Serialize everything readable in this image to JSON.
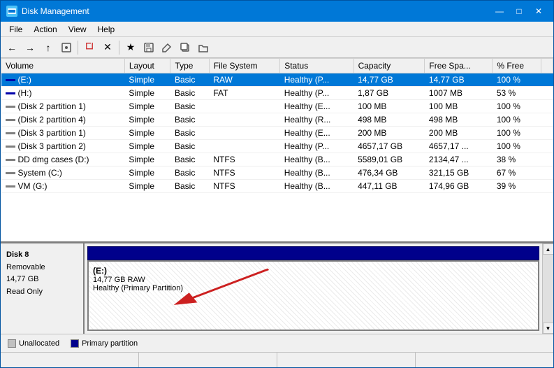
{
  "window": {
    "title": "Disk Management",
    "icon": "💿"
  },
  "titlebar": {
    "minimize": "—",
    "maximize": "□",
    "close": "✕"
  },
  "menu": {
    "items": [
      "File",
      "Action",
      "View",
      "Help"
    ]
  },
  "toolbar": {
    "buttons": [
      "←",
      "→",
      "⬆",
      "🖥",
      "📄",
      "🗑",
      "✕",
      "⭐",
      "💾",
      "✏",
      "📋",
      "📂"
    ]
  },
  "table": {
    "headers": [
      "Volume",
      "Layout",
      "Type",
      "File System",
      "Status",
      "Capacity",
      "Free Spa...",
      "% Free",
      ""
    ],
    "rows": [
      {
        "volume": "(E:)",
        "layout": "Simple",
        "type": "Basic",
        "fs": "RAW",
        "status": "Healthy (P...",
        "capacity": "14,77 GB",
        "free": "14,77 GB",
        "pct": "100 %"
      },
      {
        "volume": "(H:)",
        "layout": "Simple",
        "type": "Basic",
        "fs": "FAT",
        "status": "Healthy (P...",
        "capacity": "1,87 GB",
        "free": "1007 MB",
        "pct": "53 %"
      },
      {
        "volume": "(Disk 2 partition 1)",
        "layout": "Simple",
        "type": "Basic",
        "fs": "",
        "status": "Healthy (E...",
        "capacity": "100 MB",
        "free": "100 MB",
        "pct": "100 %"
      },
      {
        "volume": "(Disk 2 partition 4)",
        "layout": "Simple",
        "type": "Basic",
        "fs": "",
        "status": "Healthy (R...",
        "capacity": "498 MB",
        "free": "498 MB",
        "pct": "100 %"
      },
      {
        "volume": "(Disk 3 partition 1)",
        "layout": "Simple",
        "type": "Basic",
        "fs": "",
        "status": "Healthy (E...",
        "capacity": "200 MB",
        "free": "200 MB",
        "pct": "100 %"
      },
      {
        "volume": "(Disk 3 partition 2)",
        "layout": "Simple",
        "type": "Basic",
        "fs": "",
        "status": "Healthy (P...",
        "capacity": "4657,17 GB",
        "free": "4657,17 ...",
        "pct": "100 %"
      },
      {
        "volume": "DD dmg cases (D:)",
        "layout": "Simple",
        "type": "Basic",
        "fs": "NTFS",
        "status": "Healthy (B...",
        "capacity": "5589,01 GB",
        "free": "2134,47 ...",
        "pct": "38 %"
      },
      {
        "volume": "System (C:)",
        "layout": "Simple",
        "type": "Basic",
        "fs": "NTFS",
        "status": "Healthy (B...",
        "capacity": "476,34 GB",
        "free": "321,15 GB",
        "pct": "67 %"
      },
      {
        "volume": "VM (G:)",
        "layout": "Simple",
        "type": "Basic",
        "fs": "NTFS",
        "status": "Healthy (B...",
        "capacity": "447,11 GB",
        "free": "174,96 GB",
        "pct": "39 %"
      }
    ]
  },
  "disk8": {
    "name": "Disk 8",
    "type": "Removable",
    "size": "14,77 GB",
    "attr": "Read Only",
    "partition_label": "(E:)",
    "partition_info": "14,77 GB RAW",
    "partition_status": "Healthy (Primary Partition)"
  },
  "legend": {
    "items": [
      {
        "label": "Unallocated",
        "color": "#c0c0c0"
      },
      {
        "label": "Primary partition",
        "color": "#00008b"
      }
    ]
  },
  "statusbar": {
    "cells": [
      "",
      "",
      "",
      ""
    ]
  }
}
